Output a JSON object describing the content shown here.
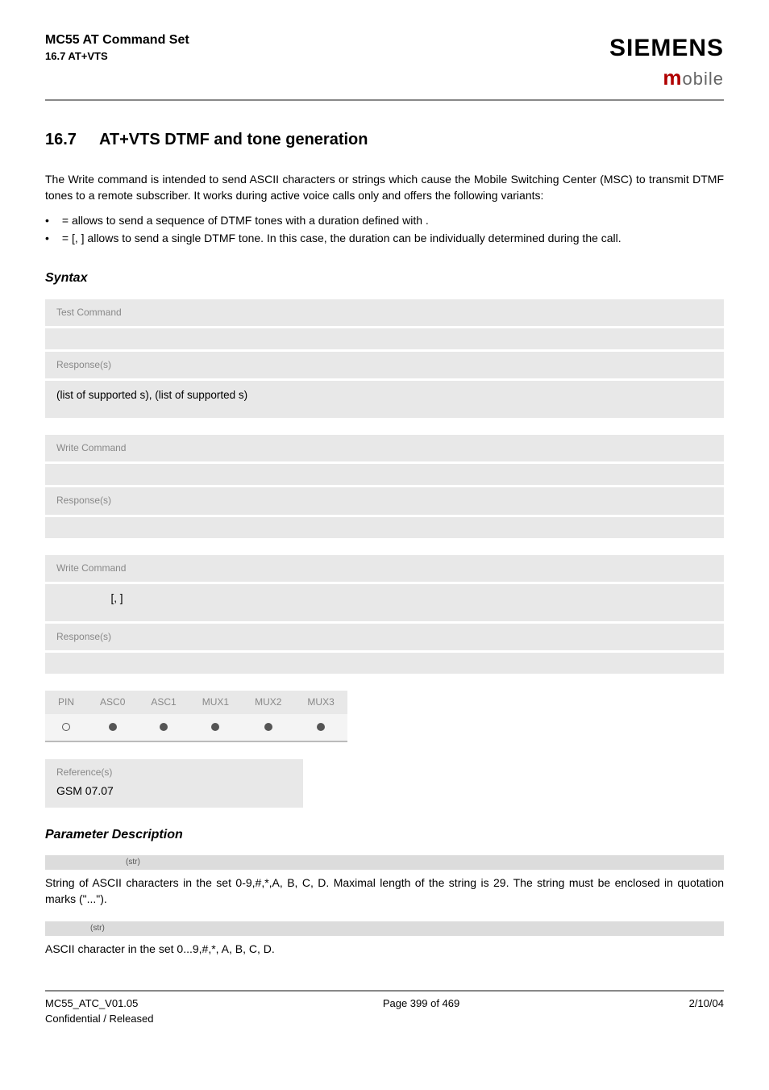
{
  "header": {
    "doc_title": "MC55 AT Command Set",
    "section_ref": "16.7 AT+VTS",
    "brand": "SIEMENS",
    "subbrand_m": "m",
    "subbrand_rest": "obile"
  },
  "heading": {
    "num": "16.7",
    "title": "AT+VTS   DTMF and tone generation"
  },
  "intro": "The Write command is intended to send ASCII characters or strings which cause the Mobile Switching Center (MSC) to transmit DTMF tones to a remote subscriber. It works during active voice calls only and offers the following variants:",
  "bullets": [
    "=                 allows to send a sequence of DTMF tones with a duration defined with            .",
    "=         [,                 ] allows to send a single DTMF tone. In this case, the duration can be individually determined during the call."
  ],
  "syntax_heading": "Syntax",
  "blocks": {
    "test_label": "Test Command",
    "test_cmd": "",
    "resp_label": "Response(s)",
    "test_resp": "(list of supported           s), (list of supported                    s)",
    "write1_label": "Write Command",
    "write1_cmd": "",
    "write1_resp": "",
    "write2_label": "Write Command",
    "write2_cmd": "[,                ]",
    "write2_resp": ""
  },
  "matrix": {
    "headers": [
      "PIN",
      "ASC0",
      "ASC1",
      "MUX1",
      "MUX2",
      "MUX3"
    ],
    "cells": [
      "open",
      "filled",
      "filled",
      "filled",
      "filled",
      "filled"
    ]
  },
  "reference": {
    "label": "Reference(s)",
    "value": "GSM 07.07"
  },
  "param_heading": "Parameter Description",
  "params": [
    {
      "sup": "(str)",
      "text": "String of ASCII characters in the set 0-9,#,*,A, B, C, D. Maximal length of the string is 29. The string must be enclosed in quotation marks (\"...\")."
    },
    {
      "sup": "(str)",
      "text": "ASCII character in the set 0...9,#,*, A, B, C, D."
    }
  ],
  "footer": {
    "left1": "MC55_ATC_V01.05",
    "left2": "Confidential / Released",
    "center": "Page 399 of 469",
    "right": "2/10/04"
  }
}
